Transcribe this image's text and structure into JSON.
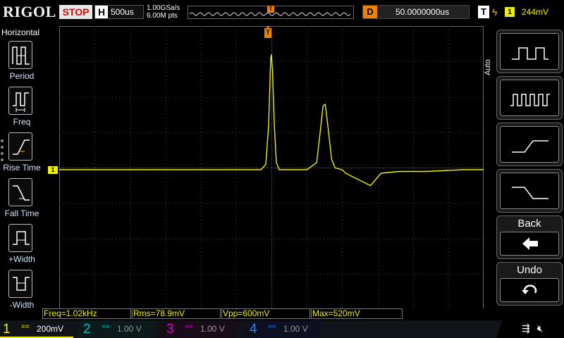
{
  "brand": "RIGOL",
  "run_state": "STOP",
  "horizontal": {
    "tag": "H",
    "timebase": "500us"
  },
  "acquisition": {
    "sample_rate": "1.00GSa/s",
    "memory_depth": "6.00M pts"
  },
  "delay": {
    "tag": "D",
    "value": "50.0000000us"
  },
  "trigger": {
    "tag": "T",
    "edge_icon": "rising-edge-icon",
    "source": "1",
    "level": "244mV"
  },
  "left_menu": {
    "title": "Horizontal",
    "items": [
      {
        "label": "Period",
        "icon": "period-icon"
      },
      {
        "label": "Freq",
        "icon": "frequency-icon"
      },
      {
        "label": "Rise Time",
        "icon": "rise-time-icon"
      },
      {
        "label": "Fall Time",
        "icon": "fall-time-icon"
      },
      {
        "label": "+Width",
        "icon": "positive-width-icon"
      },
      {
        "label": "-Width",
        "icon": "negative-width-icon"
      }
    ]
  },
  "right_menu": {
    "mode_label": "Auto",
    "buttons": [
      {
        "icon": "single-pulse-icon"
      },
      {
        "icon": "pulse-train-icon"
      },
      {
        "icon": "rising-edge-icon"
      },
      {
        "icon": "falling-edge-icon"
      }
    ],
    "back_label": "Back",
    "undo_label": "Undo"
  },
  "screen_markers": {
    "trigger_pos": "T",
    "channel1_ground": "1"
  },
  "measurements": [
    {
      "label": "Freq=1.02kHz"
    },
    {
      "label": "Rms=78.9mV"
    },
    {
      "label": "Vpp=600mV"
    },
    {
      "label": "Max=520mV"
    }
  ],
  "channels": [
    {
      "num": "1",
      "coupling": "==",
      "scale": "200mV",
      "color": "#f0f000",
      "active": true
    },
    {
      "num": "2",
      "coupling": "==",
      "scale": "1.00 V",
      "color": "#00c0c0",
      "active": false
    },
    {
      "num": "3",
      "coupling": "==",
      "scale": "1.00 V",
      "color": "#d000d0",
      "active": false
    },
    {
      "num": "4",
      "coupling": "==",
      "scale": "1.00 V",
      "color": "#3080ff",
      "active": false
    }
  ],
  "status_icons": [
    "usb-icon",
    "speaker-muted-icon"
  ],
  "colors": {
    "trace": "#f0f000",
    "trigger_marker": "#f08000",
    "grid": "#3a3a3a",
    "stop": "#e00000"
  },
  "chart_data": {
    "type": "line",
    "title": "",
    "xlabel": "",
    "ylabel": "",
    "x_divisions": 12,
    "y_divisions": 8,
    "time_per_div_us": 500,
    "volts_per_div_mV": 200,
    "series": [
      {
        "points": [
          [
            -3000,
            0
          ],
          [
            -500,
            0
          ],
          [
            -150,
            0
          ],
          [
            -80,
            30
          ],
          [
            -40,
            250
          ],
          [
            -10,
            630
          ],
          [
            0,
            650
          ],
          [
            15,
            560
          ],
          [
            40,
            260
          ],
          [
            70,
            40
          ],
          [
            110,
            0
          ],
          [
            500,
            0
          ],
          [
            640,
            40
          ],
          [
            700,
            250
          ],
          [
            730,
            360
          ],
          [
            760,
            370
          ],
          [
            800,
            240
          ],
          [
            850,
            60
          ],
          [
            900,
            10
          ],
          [
            1000,
            0
          ],
          [
            1050,
            -20
          ],
          [
            1200,
            -50
          ],
          [
            1400,
            -90
          ],
          [
            1550,
            -20
          ],
          [
            1800,
            -10
          ],
          [
            2200,
            -10
          ],
          [
            2700,
            0
          ],
          [
            3000,
            0
          ]
        ]
      }
    ]
  }
}
